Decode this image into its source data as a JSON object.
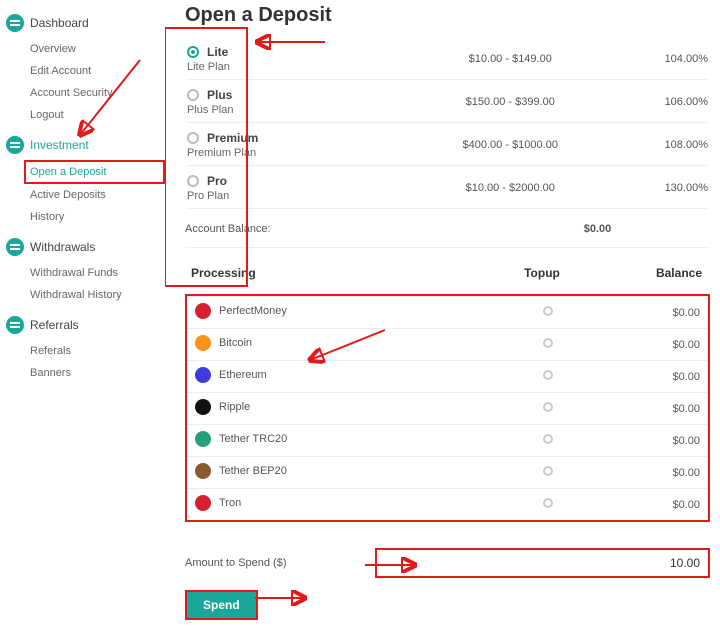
{
  "title": "Open a Deposit",
  "sidebar": [
    {
      "label": "Dashboard",
      "active": false,
      "children": [
        {
          "label": "Overview"
        },
        {
          "label": "Edit Account"
        },
        {
          "label": "Account Security"
        },
        {
          "label": "Logout"
        }
      ]
    },
    {
      "label": "Investment",
      "active": true,
      "children": [
        {
          "label": "Open a Deposit",
          "selected": true
        },
        {
          "label": "Active Deposits"
        },
        {
          "label": "History"
        }
      ]
    },
    {
      "label": "Withdrawals",
      "active": false,
      "children": [
        {
          "label": "Withdrawal Funds"
        },
        {
          "label": "Withdrawal History"
        }
      ]
    },
    {
      "label": "Referrals",
      "active": false,
      "children": [
        {
          "label": "Referals"
        },
        {
          "label": "Banners"
        }
      ]
    }
  ],
  "plans": [
    {
      "name": "Lite",
      "desc": "Lite Plan",
      "range": "$10.00 - $149.00",
      "rate": "104.00%",
      "selected": true
    },
    {
      "name": "Plus",
      "desc": "Plus Plan",
      "range": "$150.00 - $399.00",
      "rate": "106.00%",
      "selected": false
    },
    {
      "name": "Premium",
      "desc": "Premium Plan",
      "range": "$400.00 - $1000.00",
      "rate": "108.00%",
      "selected": false
    },
    {
      "name": "Pro",
      "desc": "Pro Plan",
      "range": "$10.00 - $2000.00",
      "rate": "130.00%",
      "selected": false
    }
  ],
  "balance": {
    "label": "Account Balance:",
    "value": "$0.00"
  },
  "processing": {
    "headers": {
      "name": "Processing",
      "topup": "Topup",
      "balance": "Balance"
    },
    "rows": [
      {
        "name": "PerfectMoney",
        "color": "#d52030",
        "balance": "$0.00"
      },
      {
        "name": "Bitcoin",
        "color": "#f7931a",
        "balance": "$0.00"
      },
      {
        "name": "Ethereum",
        "color": "#3c3cde",
        "balance": "$0.00"
      },
      {
        "name": "Ripple",
        "color": "#111111",
        "balance": "$0.00"
      },
      {
        "name": "Tether TRC20",
        "color": "#26a17b",
        "balance": "$0.00"
      },
      {
        "name": "Tether BEP20",
        "color": "#8b5a2b",
        "balance": "$0.00"
      },
      {
        "name": "Tron",
        "color": "#d52030",
        "balance": "$0.00"
      }
    ]
  },
  "amount": {
    "label": "Amount to Spend ($)",
    "value": "10.00"
  },
  "spend_label": "Spend",
  "colors": {
    "accent": "#19a79b",
    "highlight": "#e11b1b"
  }
}
